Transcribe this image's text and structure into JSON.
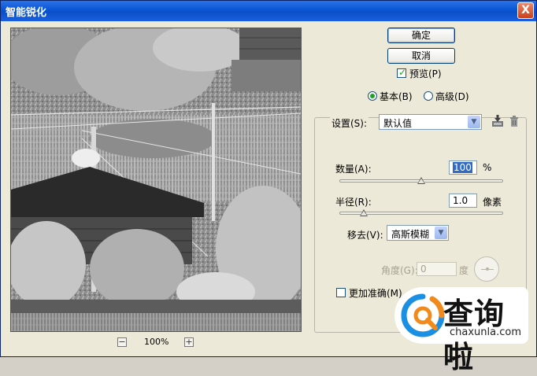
{
  "window": {
    "title": "智能锐化",
    "close_label": "X"
  },
  "zoom": {
    "minus": "−",
    "level": "100%",
    "plus": "+"
  },
  "buttons": {
    "ok": "确定",
    "cancel": "取消"
  },
  "preview_checkbox": {
    "label": "预览(P)",
    "checked": true
  },
  "mode": {
    "basic": "基本(B)",
    "advanced": "高级(D)",
    "selected": "basic"
  },
  "settings": {
    "label": "设置(S):",
    "value": "默认值",
    "save_icon": "save-preset-icon",
    "delete_icon": "trash-icon"
  },
  "amount": {
    "label": "数量(A):",
    "value": "100",
    "unit": "%",
    "slider_fraction": 0.5
  },
  "radius": {
    "label": "半径(R):",
    "value": "1.0",
    "unit": "像素",
    "slider_fraction": 0.15
  },
  "remove": {
    "label": "移去(V):",
    "value": "高斯模糊"
  },
  "angle": {
    "label": "角度(G):",
    "value": "0",
    "unit": "度",
    "enabled": false
  },
  "more_accurate": {
    "label": "更加准确(M)",
    "checked": false
  },
  "watermark": {
    "brand": "查询啦",
    "domain": "chaxunla.com"
  },
  "colors": {
    "title_bar": "#0a55d4",
    "dialog_bg": "#ece9d8",
    "accent_check": "#21a121",
    "selection": "#316ac5"
  }
}
